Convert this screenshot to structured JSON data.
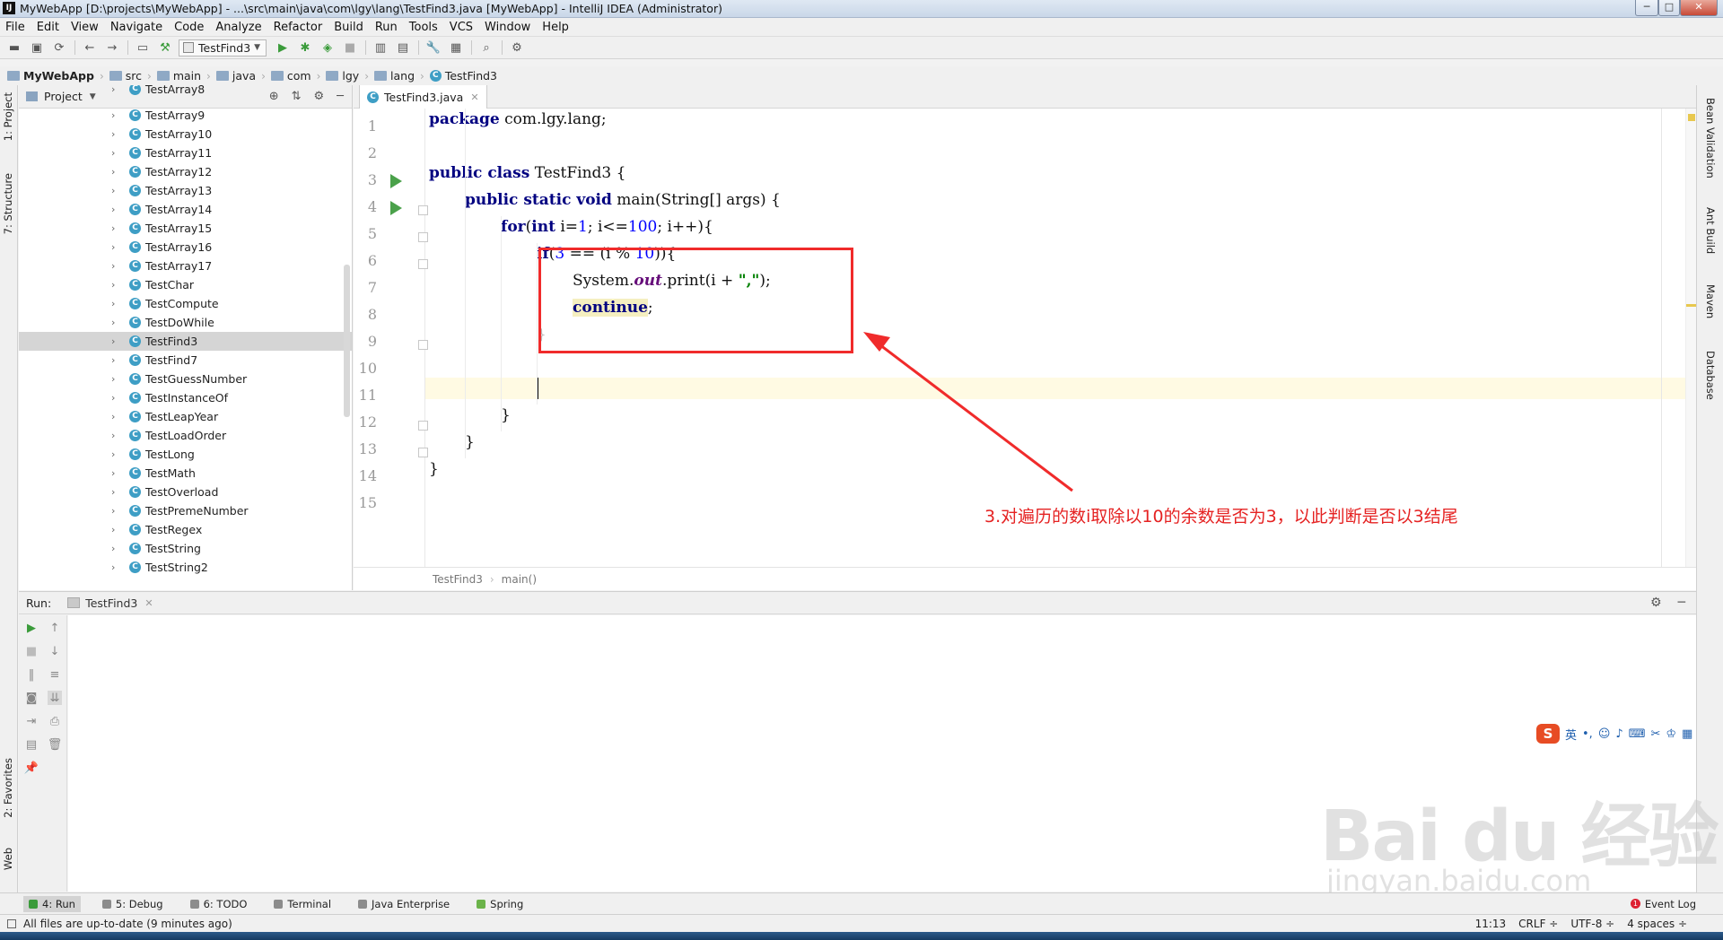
{
  "window": {
    "title": "MyWebApp [D:\\projects\\MyWebApp] - ...\\src\\main\\java\\com\\lgy\\lang\\TestFind3.java [MyWebApp] - IntelliJ IDEA (Administrator)",
    "app_icon": "IJ",
    "minimize": "─",
    "maximize": "□",
    "close": "✕"
  },
  "menu": [
    "File",
    "Edit",
    "View",
    "Navigate",
    "Code",
    "Analyze",
    "Refactor",
    "Build",
    "Run",
    "Tools",
    "VCS",
    "Window",
    "Help"
  ],
  "toolbar": {
    "run_config": "TestFind3"
  },
  "navbar": {
    "crumbs": [
      "MyWebApp",
      "src",
      "main",
      "java",
      "com",
      "lgy",
      "lang",
      "TestFind3"
    ]
  },
  "left_strip": {
    "project": "1: Project",
    "structure": "7: Structure",
    "favorites": "2: Favorites",
    "web": "Web"
  },
  "project_panel": {
    "title": "Project",
    "items": [
      "TestArray8",
      "TestArray9",
      "TestArray10",
      "TestArray11",
      "TestArray12",
      "TestArray13",
      "TestArray14",
      "TestArray15",
      "TestArray16",
      "TestArray17",
      "TestChar",
      "TestCompute",
      "TestDoWhile",
      "TestFind3",
      "TestFind7",
      "TestGuessNumber",
      "TestInstanceOf",
      "TestLeapYear",
      "TestLoadOrder",
      "TestLong",
      "TestMath",
      "TestOverload",
      "TestPremeNumber",
      "TestRegex",
      "TestString",
      "TestString2"
    ],
    "selected": "TestFind3"
  },
  "editor": {
    "tab": "TestFind3.java",
    "line_numbers": [
      "1",
      "2",
      "3",
      "4",
      "5",
      "6",
      "7",
      "8",
      "9",
      "10",
      "11",
      "12",
      "13",
      "14",
      "15"
    ],
    "breadcrumb": [
      "TestFind3",
      "main()"
    ],
    "code": {
      "l1_kw": "package",
      "l1_rest": " com.lgy.lang;",
      "l3_kw": "public class",
      "l3_rest": " TestFind3 {",
      "l4_kw": "public static void",
      "l4_rest": " main(String[] args) {",
      "l5_kw1": "for",
      "l5_p1": "(",
      "l5_kw2": "int",
      "l5_p2": " i=",
      "l5_n1": "1",
      "l5_p3": "; i<=",
      "l5_n2": "100",
      "l5_p4": "; i++){",
      "l6_kw": "if",
      "l6_p1": "(",
      "l6_n1": "3",
      "l6_p2": " == (i % ",
      "l6_n2": "10",
      "l6_p3": ")){",
      "l7_p1": "System.",
      "l7_fld": "out",
      "l7_p2": ".print(i + ",
      "l7_str": "\",\"",
      "l7_p3": ");",
      "l8_kw": "continue",
      "l8_p": ";",
      "l9": "}",
      "l12": "}",
      "l13": "}",
      "l14": "}"
    }
  },
  "right_strip": [
    "Bean Validation",
    "Ant Build",
    "Maven",
    "Database"
  ],
  "annotation": {
    "text": "3.对遍历的数i取除以10的余数是否为3，以此判断是否以3结尾",
    "color": "#e52222"
  },
  "run_panel": {
    "label": "Run:",
    "tab": "TestFind3"
  },
  "ime": {
    "logo": "S",
    "lang": "英"
  },
  "watermark": {
    "main": "Bai du 经验",
    "sub": "jingyan.baidu.com"
  },
  "bottom_tabs": {
    "run": "4: Run",
    "debug": "5: Debug",
    "todo": "6: TODO",
    "terminal": "Terminal",
    "java_ee": "Java Enterprise",
    "spring": "Spring",
    "event_log": "Event Log",
    "event_count": "1"
  },
  "status": {
    "message": "All files are up-to-date (9 minutes ago)",
    "position": "11:13",
    "line_sep": "CRLF ÷",
    "encoding": "UTF-8 ÷",
    "indent": "4 spaces ÷"
  }
}
